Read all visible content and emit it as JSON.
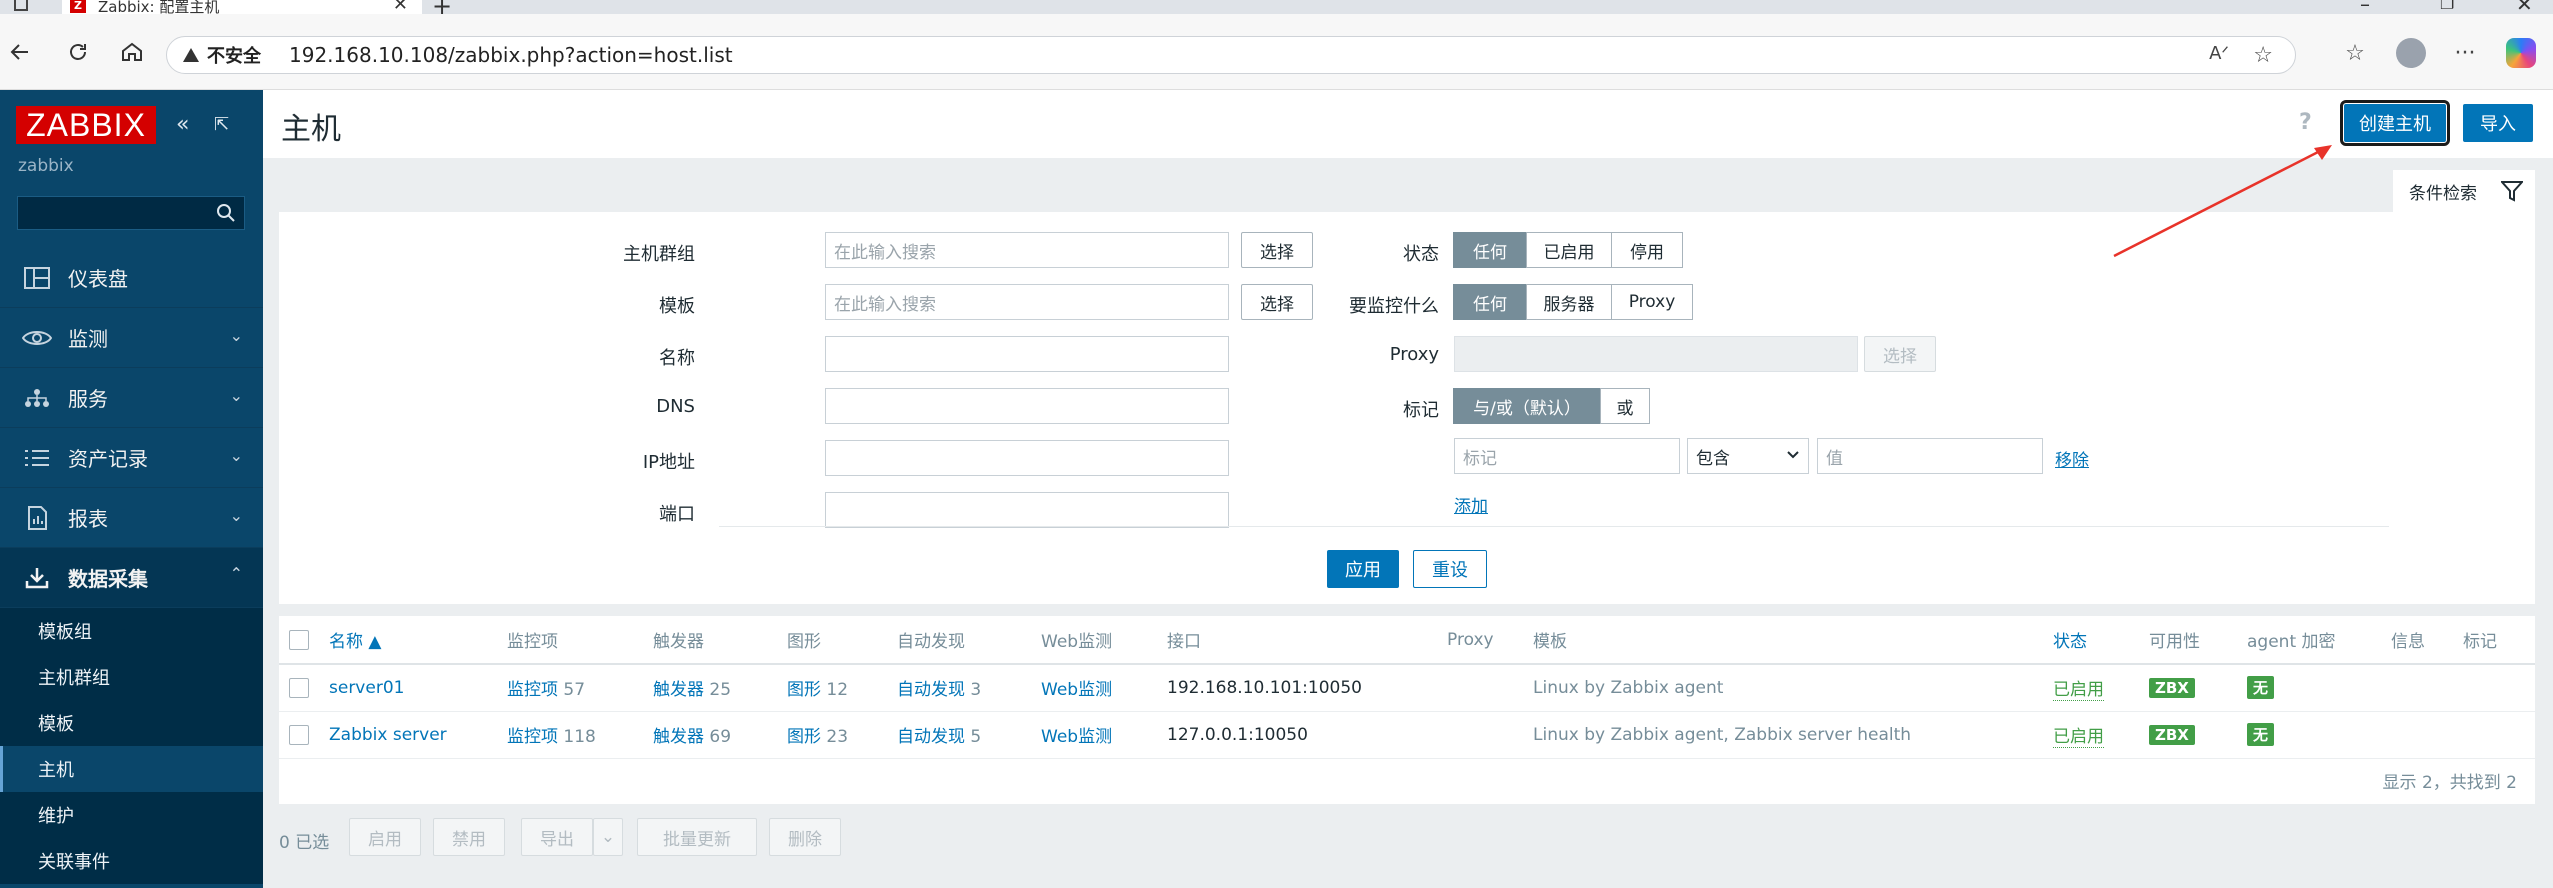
{
  "browser": {
    "tab_title": "Zabbix: 配置主机",
    "favicon_letter": "Z",
    "security_label": "不安全",
    "url": "192.168.10.108/zabbix.php?action=host.list"
  },
  "sidebar": {
    "logo": "ZABBIX",
    "user": "zabbix",
    "search_placeholder": "",
    "items": [
      {
        "label": "仪表盘",
        "icon": "dashboard-icon"
      },
      {
        "label": "监测",
        "icon": "eye-icon"
      },
      {
        "label": "服务",
        "icon": "services-icon"
      },
      {
        "label": "资产记录",
        "icon": "list-icon"
      },
      {
        "label": "报表",
        "icon": "report-icon"
      },
      {
        "label": "数据采集",
        "icon": "download-icon"
      }
    ],
    "subitems": [
      "模板组",
      "主机群组",
      "模板",
      "主机",
      "维护",
      "关联事件"
    ],
    "selected_subitem": "主机"
  },
  "header": {
    "title": "主机",
    "help": "?",
    "create_host": "创建主机",
    "import": "导入"
  },
  "filter": {
    "tab_label": "条件检索",
    "host_groups_label": "主机群组",
    "host_groups_placeholder": "在此输入搜索",
    "templates_label": "模板",
    "templates_placeholder": "在此输入搜索",
    "select_btn": "选择",
    "name_label": "名称",
    "dns_label": "DNS",
    "ip_label": "IP地址",
    "port_label": "端口",
    "status_label": "状态",
    "status_options": [
      "任何",
      "已启用",
      "停用"
    ],
    "monitored_by_label": "要监控什么",
    "monitored_by_options": [
      "任何",
      "服务器",
      "Proxy"
    ],
    "proxy_label": "Proxy",
    "tags_label": "标记",
    "tags_options": [
      "与/或（默认）",
      "或"
    ],
    "tag_placeholder": "标记",
    "tag_operator": "包含",
    "tag_value_placeholder": "值",
    "remove_link": "移除",
    "add_link": "添加",
    "apply": "应用",
    "reset": "重设"
  },
  "table": {
    "columns": [
      "名称 ▲",
      "监控项",
      "触发器",
      "图形",
      "自动发现",
      "Web监测",
      "接口",
      "Proxy",
      "模板",
      "状态",
      "可用性",
      "agent 加密",
      "信息",
      "标记"
    ],
    "rows": [
      {
        "name": "server01",
        "items_label": "监控项",
        "items_count": "57",
        "triggers_label": "触发器",
        "triggers_count": "25",
        "graphs_label": "图形",
        "graphs_count": "12",
        "discovery_label": "自动发现",
        "discovery_count": "3",
        "web": "Web监测",
        "interface": "192.168.10.101:10050",
        "proxy": "",
        "templates": "Linux by Zabbix agent",
        "templates_extra": "",
        "status": "已启用",
        "availability": "ZBX",
        "encryption": "无"
      },
      {
        "name": "Zabbix server",
        "items_label": "监控项",
        "items_count": "118",
        "triggers_label": "触发器",
        "triggers_count": "69",
        "graphs_label": "图形",
        "graphs_count": "23",
        "discovery_label": "自动发现",
        "discovery_count": "5",
        "web": "Web监测",
        "interface": "127.0.0.1:10050",
        "proxy": "",
        "templates": "Linux by Zabbix agent",
        "templates_extra": ", Zabbix server health",
        "status": "已启用",
        "availability": "ZBX",
        "encryption": "无"
      }
    ],
    "footer": "显示 2，共找到 2"
  },
  "mass_actions": {
    "selected": "0 已选",
    "buttons": [
      "启用",
      "禁用",
      "导出",
      "批量更新",
      "删除"
    ]
  },
  "colors": {
    "sidebar_bg": "#0a466a",
    "primary": "#0275b8",
    "logo_red": "#d40000",
    "enabled_green": "#429e47",
    "annotation_arrow": "#e8332a"
  }
}
